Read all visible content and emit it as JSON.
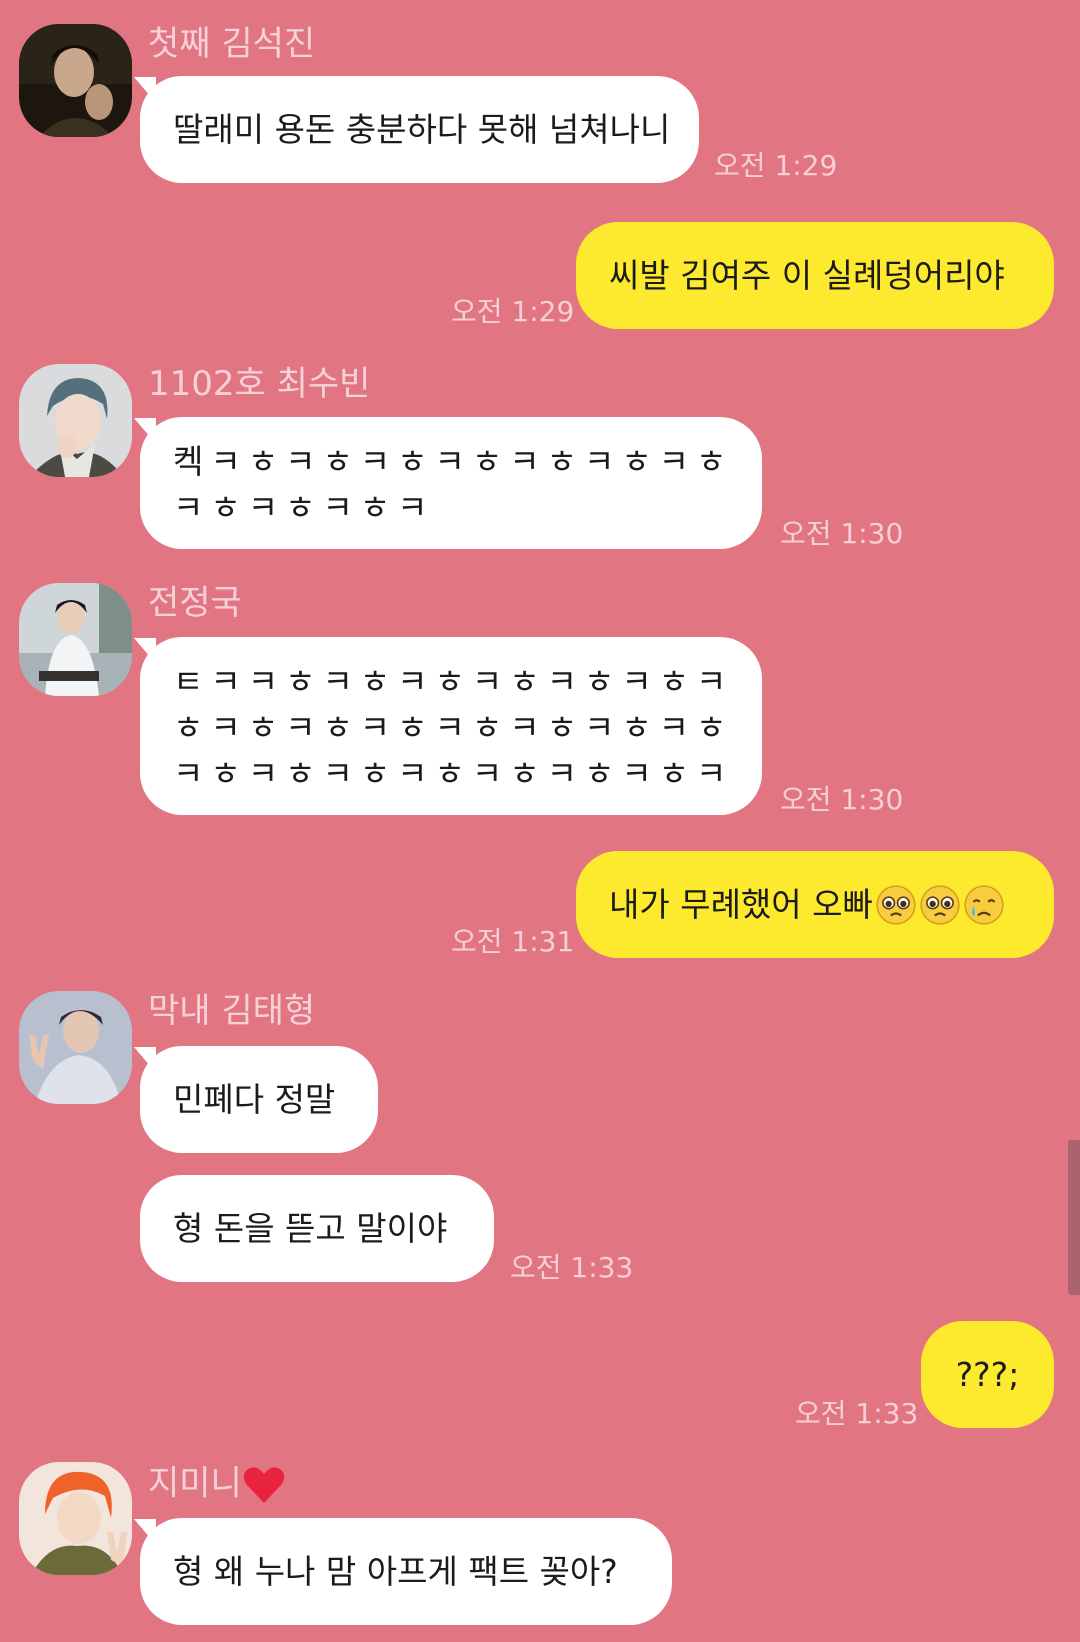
{
  "theme": {
    "background": "#e27582",
    "incoming_bubble": "#ffffff",
    "outgoing_bubble": "#fde92e"
  },
  "messages": [
    {
      "sender": "첫째 김석진",
      "avatar_icon": "profile-photo-jin",
      "text": "딸래미 용돈 충분하다 못해 넘쳐나니",
      "time": "오전 1:29"
    },
    {
      "sender": "me",
      "text": "씨발 김여주 이 실례덩어리야",
      "time": "오전 1:29"
    },
    {
      "sender": "1102호 최수빈",
      "avatar_icon": "profile-photo-soobin",
      "lines": [
        "켁ㅋㅎㅋㅎㅋㅎㅋㅎㅋㅎㅋㅎㅋㅎ",
        "ㅋㅎㅋㅎㅋㅎㅋ"
      ],
      "time": "오전 1:30"
    },
    {
      "sender": "전정국",
      "avatar_icon": "profile-photo-jungkook",
      "lines": [
        "ㅌㅋㅋㅎㅋㅎㅋㅎㅋㅎㅋㅎㅋㅎㅋ",
        "ㅎㅋㅎㅋㅎㅋㅎㅋㅎㅋㅎㅋㅎㅋㅎ",
        "ㅋㅎㅋㅎㅋㅎㅋㅎㅋㅎㅋㅎㅋㅎㅋ"
      ],
      "time": "오전 1:30"
    },
    {
      "sender": "me",
      "text": "내가 무례했어 오빠",
      "emojis": [
        "pleading-face-icon",
        "pleading-face-icon",
        "crying-face-icon"
      ],
      "time": "오전 1:31"
    },
    {
      "sender": "막내 김태형",
      "avatar_icon": "profile-photo-taehyung",
      "text": "민폐다 정말"
    },
    {
      "sender": "막내 김태형",
      "text": "형 돈을 뜯고 말이야",
      "time": "오전 1:33"
    },
    {
      "sender": "me",
      "text": "???;",
      "time": "오전 1:33"
    },
    {
      "sender": "지미니",
      "sender_suffix_icon": "red-heart-icon",
      "avatar_icon": "profile-photo-jimin",
      "text": "형 왜 누나 맘 아프게 팩트 꽂아?"
    }
  ]
}
